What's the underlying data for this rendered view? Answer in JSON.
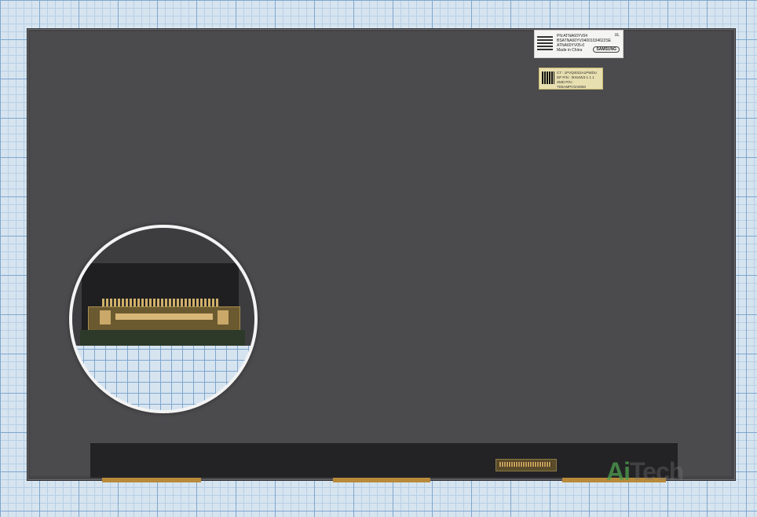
{
  "label_top": {
    "line1": "PN:ATNA60YV04",
    "line2": "BSATNA60YV04001034622SE",
    "line3": "ATNA60YV05-0",
    "line4": "Made in China",
    "brand": "SAMSUNG",
    "cert": "UL"
  },
  "label_second": {
    "line1": "CT : 1PVQ0022A1PWDU",
    "line2": "DP P/N : 0H54W3-1 1 1",
    "line3": "SMD P/N : TD5AMPC0A5060"
  },
  "watermark": {
    "lead": "Ai",
    "rest": "Tech"
  }
}
